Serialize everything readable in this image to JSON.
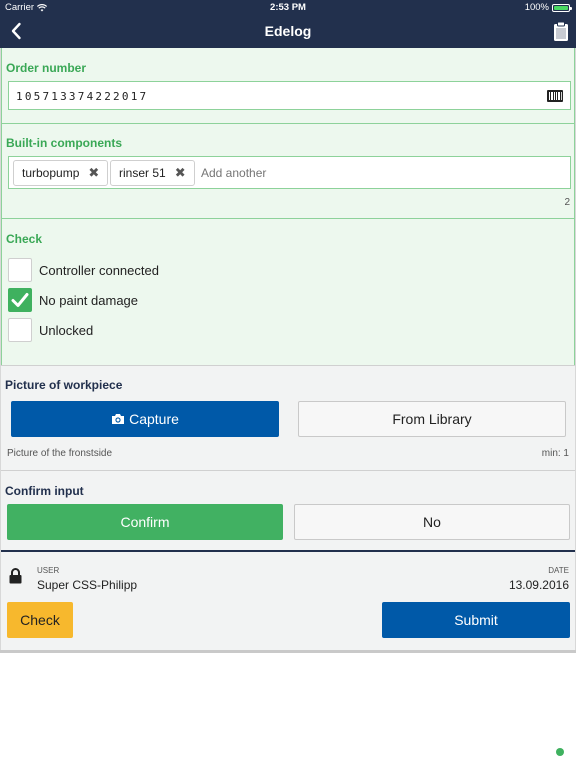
{
  "status": {
    "carrier": "Carrier",
    "time": "2:53 PM",
    "battery": "100%",
    "battery_level": 1.0
  },
  "nav": {
    "title": "Edelog",
    "back_icon": "chevron-left-icon",
    "action_icon": "clipboard-icon"
  },
  "order": {
    "label": "Order number",
    "value": "105713374222017",
    "scan_icon": "barcode-icon"
  },
  "components": {
    "label": "Built-in components",
    "tags": [
      "turbopump",
      "rinser 51"
    ],
    "remove_icon": "close-icon",
    "placeholder": "Add another",
    "count": "2"
  },
  "check": {
    "label": "Check",
    "items": [
      {
        "label": "Controller connected",
        "checked": false
      },
      {
        "label": "No paint damage",
        "checked": true
      },
      {
        "label": "Unlocked",
        "checked": false
      }
    ]
  },
  "picture": {
    "label": "Picture of workpiece",
    "capture_label": "Capture",
    "capture_icon": "camera-icon",
    "library_label": "From Library",
    "hint": "Picture of the fronstside",
    "min": "min: 1"
  },
  "confirm": {
    "label": "Confirm input",
    "yes_label": "Confirm",
    "no_label": "No"
  },
  "footer": {
    "lock_icon": "lock-icon",
    "user_label": "USER",
    "user_value": "Super CSS-Philipp",
    "date_label": "DATE",
    "date_value": "13.09.2016",
    "check_label": "Check",
    "submit_label": "Submit"
  },
  "colors": {
    "navbar": "#22304d",
    "accent_green": "#3aa856",
    "primary_blue": "#0059a8",
    "warning_yellow": "#f7b82d"
  }
}
